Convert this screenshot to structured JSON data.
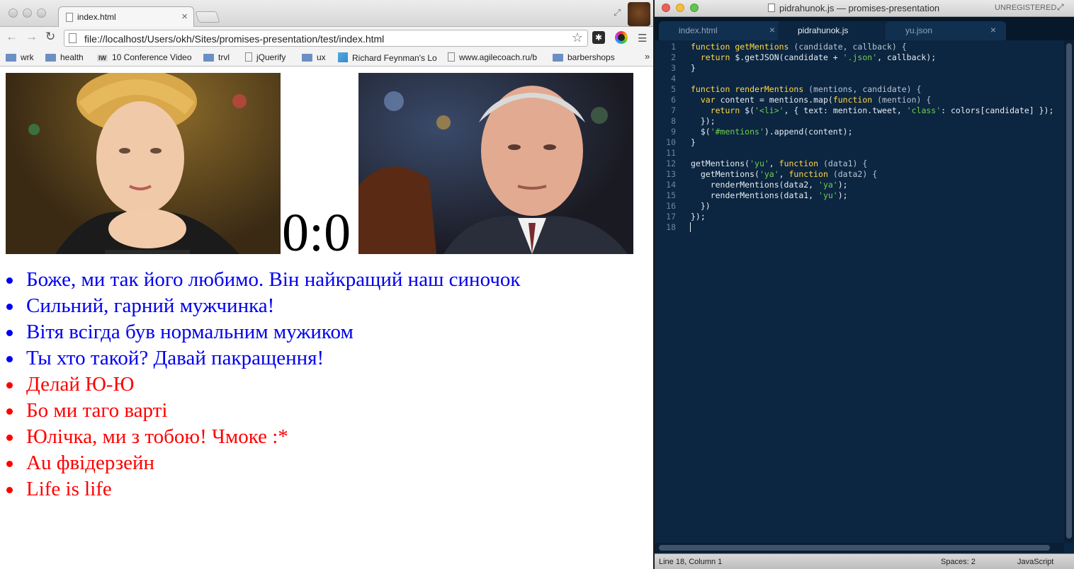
{
  "browser": {
    "tab_title": "index.html",
    "url": "file://localhost/Users/okh/Sites/promises-presentation/test/index.html",
    "bookmarks": [
      {
        "label": "wrk",
        "icon": "folder-icon"
      },
      {
        "label": "health",
        "icon": "folder-icon"
      },
      {
        "label": "10 Conference Video",
        "icon": "iw-icon",
        "badge": "IW"
      },
      {
        "label": "trvl",
        "icon": "folder-icon"
      },
      {
        "label": "jQuerify",
        "icon": "page-icon"
      },
      {
        "label": "ux",
        "icon": "folder-icon"
      },
      {
        "label": "Richard Feynman's Lo",
        "icon": "site-icon"
      },
      {
        "label": "www.agilecoach.ru/b",
        "icon": "page-icon"
      },
      {
        "label": "barbershops",
        "icon": "folder-icon"
      }
    ],
    "bookmarks_overflow": "»",
    "page": {
      "score": "0:0",
      "mentions": [
        {
          "text": "Боже, ми так його любимо. Він найкращий наш синочок",
          "color": "#0000ee"
        },
        {
          "text": "Сильний, гарний мужчинка!",
          "color": "#0000ee"
        },
        {
          "text": "Вітя всігда був нормальним мужиком",
          "color": "#0000ee"
        },
        {
          "text": "Ты хто такой? Давай пакращення!",
          "color": "#0000ee"
        },
        {
          "text": "Делай Ю-Ю",
          "color": "#ff0000"
        },
        {
          "text": "Бо ми таго варті",
          "color": "#ff0000"
        },
        {
          "text": "Юлічка, ми з тобою! Чмоке :*",
          "color": "#ff0000"
        },
        {
          "text": "Аu фвідерзейн",
          "color": "#ff0000"
        },
        {
          "text": "Life is life",
          "color": "#ff0000"
        }
      ]
    }
  },
  "editor": {
    "window_title": "pidrahunok.js — promises-presentation",
    "license_label": "UNREGISTERED",
    "tabs": [
      {
        "label": "index.html",
        "active": false
      },
      {
        "label": "pidrahunok.js",
        "active": true
      },
      {
        "label": "yu.json",
        "active": false
      }
    ],
    "code": [
      [
        [
          "kw",
          "function "
        ],
        [
          "fn",
          "getMentions"
        ],
        [
          "prm",
          " (candidate, callback) {"
        ]
      ],
      [
        [
          "punc",
          "  "
        ],
        [
          "kw",
          "return "
        ],
        [
          "punc",
          "$.getJSON(candidate + "
        ],
        [
          "str",
          "'.json'"
        ],
        [
          "punc",
          ", callback);"
        ]
      ],
      [
        [
          "punc",
          "}"
        ]
      ],
      [],
      [
        [
          "kw",
          "function "
        ],
        [
          "fn",
          "renderMentions"
        ],
        [
          "prm",
          " (mentions, candidate) {"
        ]
      ],
      [
        [
          "punc",
          "  "
        ],
        [
          "kw",
          "var "
        ],
        [
          "punc",
          "content = mentions.map("
        ],
        [
          "kw",
          "function "
        ],
        [
          "prm",
          "(mention) {"
        ]
      ],
      [
        [
          "punc",
          "    "
        ],
        [
          "kw",
          "return "
        ],
        [
          "punc",
          "$("
        ],
        [
          "str",
          "'<li>'"
        ],
        [
          "punc",
          ", { text: mention.tweet, "
        ],
        [
          "str",
          "'class'"
        ],
        [
          "punc",
          ": colors[candidate] });"
        ]
      ],
      [
        [
          "punc",
          "  });"
        ]
      ],
      [
        [
          "punc",
          "  $("
        ],
        [
          "str",
          "'#mentions'"
        ],
        [
          "punc",
          ").append(content);"
        ]
      ],
      [
        [
          "punc",
          "}"
        ]
      ],
      [],
      [
        [
          "punc",
          "getMentions("
        ],
        [
          "str",
          "'yu'"
        ],
        [
          "punc",
          ", "
        ],
        [
          "kw",
          "function "
        ],
        [
          "prm",
          "(data1) {"
        ]
      ],
      [
        [
          "punc",
          "  getMentions("
        ],
        [
          "str",
          "'ya'"
        ],
        [
          "punc",
          ", "
        ],
        [
          "kw",
          "function "
        ],
        [
          "prm",
          "(data2) {"
        ]
      ],
      [
        [
          "punc",
          "    renderMentions(data2, "
        ],
        [
          "str",
          "'ya'"
        ],
        [
          "punc",
          ");"
        ]
      ],
      [
        [
          "punc",
          "    renderMentions(data1, "
        ],
        [
          "str",
          "'yu'"
        ],
        [
          "punc",
          ");"
        ]
      ],
      [
        [
          "punc",
          "  })"
        ]
      ],
      [
        [
          "punc",
          "});"
        ]
      ],
      []
    ],
    "status": {
      "position": "Line 18, Column 1",
      "indent": "Spaces: 2",
      "syntax": "JavaScript"
    }
  }
}
